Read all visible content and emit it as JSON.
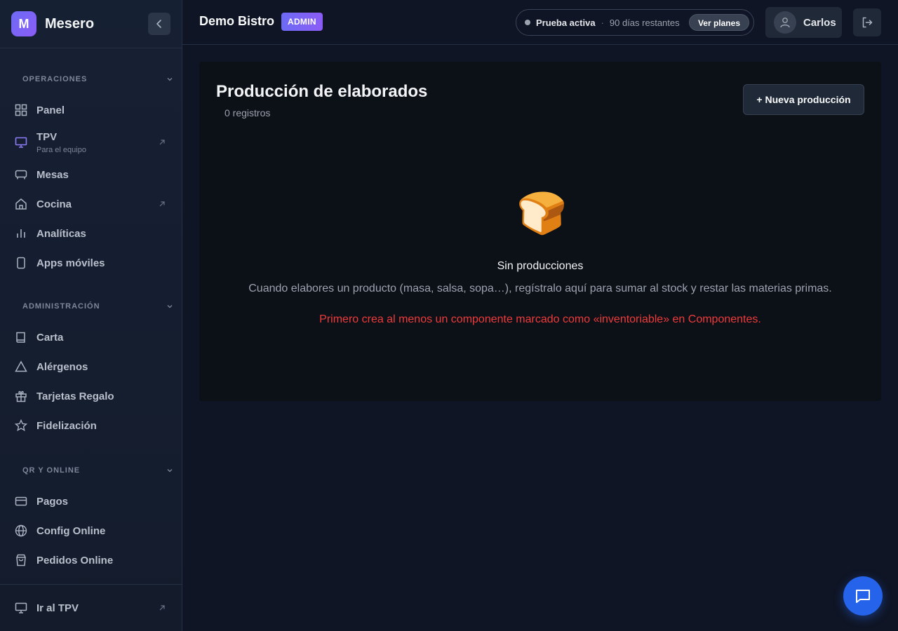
{
  "brand": {
    "logo_letter": "M",
    "name": "Mesero"
  },
  "sidebar": {
    "sections": [
      {
        "title": "OPERACIONES",
        "items": [
          {
            "label": "Panel",
            "icon": "grid-icon"
          },
          {
            "label": "TPV",
            "sub": "Para el equipo",
            "icon": "monitor-icon",
            "external": true
          },
          {
            "label": "Mesas",
            "icon": "table-icon"
          },
          {
            "label": "Cocina",
            "icon": "home-icon",
            "external": true
          },
          {
            "label": "Analíticas",
            "icon": "bar-chart-icon"
          },
          {
            "label": "Apps móviles",
            "icon": "smartphone-icon"
          }
        ]
      },
      {
        "title": "ADMINISTRACIÓN",
        "items": [
          {
            "label": "Carta",
            "icon": "book-icon"
          },
          {
            "label": "Alérgenos",
            "icon": "warning-icon"
          },
          {
            "label": "Tarjetas Regalo",
            "icon": "gift-icon"
          },
          {
            "label": "Fidelización",
            "icon": "star-icon"
          }
        ]
      },
      {
        "title": "QR Y ONLINE",
        "items": [
          {
            "label": "Pagos",
            "icon": "credit-card-icon"
          },
          {
            "label": "Config Online",
            "icon": "globe-icon"
          },
          {
            "label": "Pedidos Online",
            "icon": "shopping-bag-icon"
          }
        ]
      }
    ],
    "footer_label": "Ir al TPV"
  },
  "topbar": {
    "org_name": "Demo Bistro",
    "role_badge": "ADMIN",
    "trial_label": "Prueba activa",
    "trial_sep": "·",
    "trial_days": "90 días restantes",
    "plans_button": "Ver planes",
    "user_name": "Carlos"
  },
  "main": {
    "title": "Producción de elaborados",
    "count": "0 registros",
    "new_button": "+ Nueva producción",
    "empty_icon": "🍞",
    "empty_title": "Sin producciones",
    "empty_description": "Cuando elabores un producto (masa, salsa, sopa…), regístralo aquí para sumar al stock y restar las materias primas.",
    "empty_warning": "Primero crea al menos un componente marcado como «inventoriable» en Componentes."
  },
  "colors": {
    "accent": "#6d6bf5",
    "warning": "#ef3b3b",
    "fab": "#2563eb"
  }
}
